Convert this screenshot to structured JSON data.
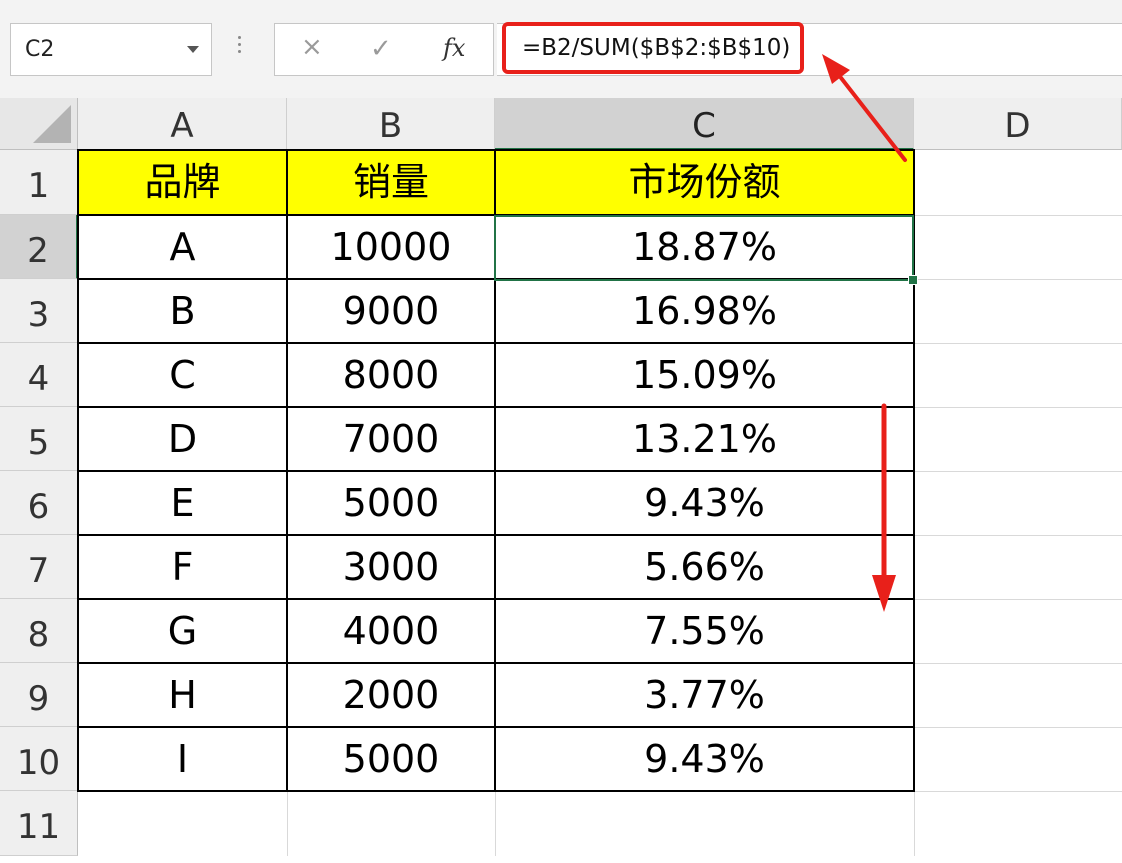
{
  "name_box": {
    "value": "C2"
  },
  "formula_bar": {
    "cancel_icon": "×",
    "enter_icon": "✓",
    "fx_label": "fx",
    "formula": "=B2/SUM($B$2:$B$10)"
  },
  "columns": [
    "A",
    "B",
    "C",
    "D"
  ],
  "rows": [
    "1",
    "2",
    "3",
    "4",
    "5",
    "6",
    "7",
    "8",
    "9",
    "10",
    "11"
  ],
  "table": {
    "headers": [
      "品牌",
      "销量",
      "市场份额"
    ],
    "data": [
      [
        "A",
        "10000",
        "18.87%"
      ],
      [
        "B",
        "9000",
        "16.98%"
      ],
      [
        "C",
        "8000",
        "15.09%"
      ],
      [
        "D",
        "7000",
        "13.21%"
      ],
      [
        "E",
        "5000",
        "9.43%"
      ],
      [
        "F",
        "3000",
        "5.66%"
      ],
      [
        "G",
        "4000",
        "7.55%"
      ],
      [
        "H",
        "2000",
        "3.77%"
      ],
      [
        "I",
        "5000",
        "9.43%"
      ]
    ]
  },
  "colors": {
    "highlight": "#ffff00",
    "selection": "#217346",
    "annotation": "#e8201a"
  },
  "annotations": [
    "arrow-pointing-to-formula",
    "arrow-pointing-down-fill"
  ]
}
